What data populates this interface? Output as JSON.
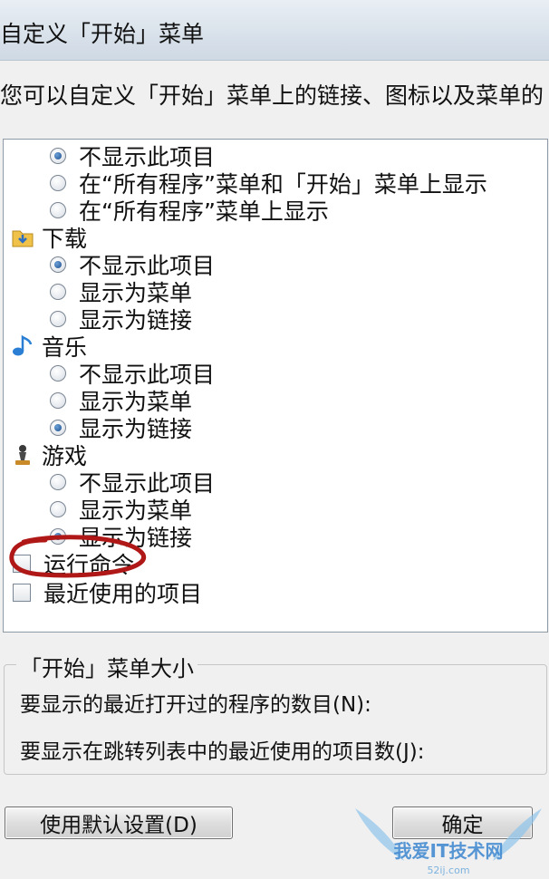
{
  "window": {
    "title": "自定义「开始」菜单"
  },
  "description": "您可以自定义「开始」菜单上的链接、图标以及菜单的",
  "options": {
    "o1": "不显示此项目",
    "o2": "在“所有程序”菜单和「开始」菜单上显示",
    "o3": "在“所有程序”菜单上显示",
    "downloads": "下载",
    "d1": "不显示此项目",
    "d2": "显示为菜单",
    "d3": "显示为链接",
    "music": "音乐",
    "m1": "不显示此项目",
    "m2": "显示为菜单",
    "m3": "显示为链接",
    "games": "游戏",
    "g1": "不显示此项目",
    "g2": "显示为菜单",
    "g3": "显示为链接",
    "run": "运行命令",
    "recent": "最近使用的项目"
  },
  "start_menu_size": {
    "title": "「开始」菜单大小",
    "recent_programs": "要显示的最近打开过的程序的数目(N):",
    "jump_list": "要显示在跳转列表中的最近使用的项目数(J):"
  },
  "buttons": {
    "defaults": "使用默认设置(D)",
    "ok": "确定"
  },
  "watermark": {
    "text": "我爱IT技术网",
    "url": "52ij.com"
  },
  "colors": {
    "annotation": "#b01818",
    "radio_dot": "#1e4f8c"
  }
}
